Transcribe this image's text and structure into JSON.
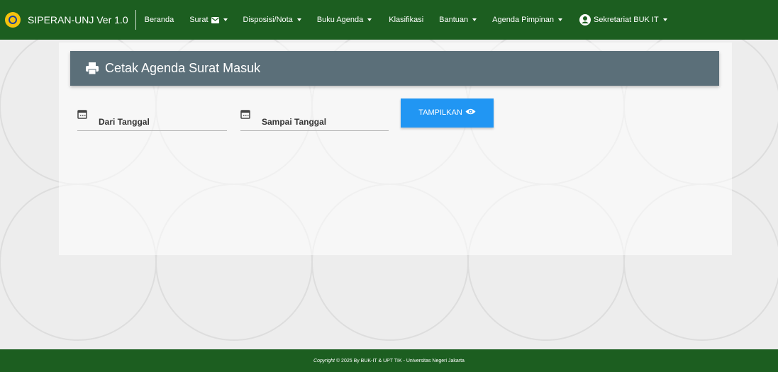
{
  "navbar": {
    "brand": "SIPERAN-UNJ Ver 1.0",
    "items": [
      {
        "label": "Beranda",
        "icon": ""
      },
      {
        "label": "Surat",
        "icon": "envelope-icon"
      },
      {
        "label": "Disposisi/Nota",
        "icon": ""
      },
      {
        "label": "Buku Agenda",
        "icon": ""
      },
      {
        "label": "Klasifikasi",
        "icon": ""
      },
      {
        "label": "Bantuan",
        "icon": ""
      },
      {
        "label": "Agenda Pimpinan",
        "icon": ""
      }
    ],
    "user": "Sekretariat BUK IT"
  },
  "page": {
    "title": "Cetak Agenda Surat Masuk",
    "title_icon": "printer-icon"
  },
  "form": {
    "from_label": "Dari Tanggal",
    "to_label": "Sampai Tanggal",
    "submit_label": "TAMPILKAN",
    "submit_icon": "eye-icon"
  },
  "footer": {
    "copyright_word": "Copyright",
    "text": "© 2025 By BUK-IT & UPT TIK - Universitas Negeri Jakarta"
  },
  "colors": {
    "navbar": "#1c5e20",
    "header": "#5b6f79",
    "button": "#2196f3"
  }
}
